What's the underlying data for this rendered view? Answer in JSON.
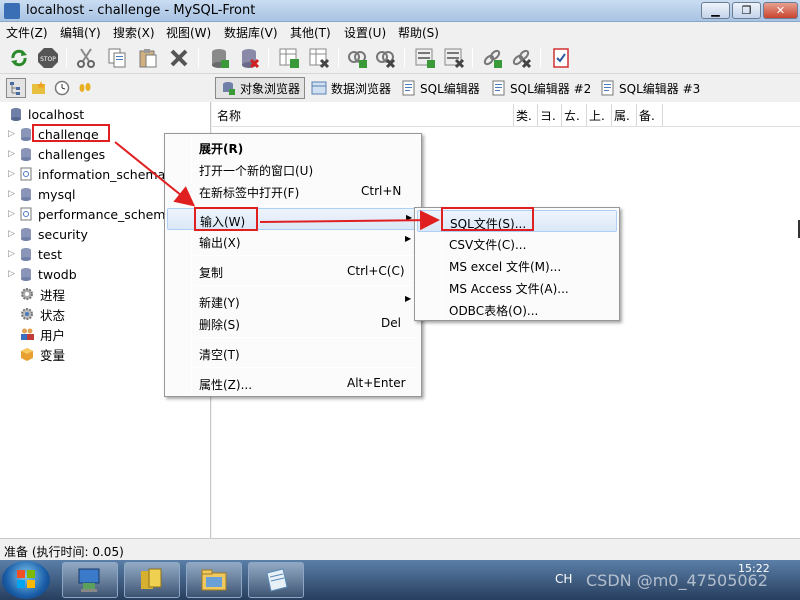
{
  "window": {
    "title": "localhost - challenge - MySQL-Front",
    "min": "▁",
    "max": "❐",
    "close": "✕"
  },
  "menubar": [
    "文件(Z)",
    "编辑(Y)",
    "搜索(X)",
    "视图(W)",
    "数据库(V)",
    "其他(T)",
    "设置(U)",
    "帮助(S)"
  ],
  "toolbar2": {
    "buttons": [
      "对象浏览器",
      "数据浏览器",
      "SQL编辑器",
      "SQL编辑器 #2",
      "SQL编辑器 #3"
    ],
    "active": "对象浏览器"
  },
  "tree": {
    "root": "localhost",
    "databases": [
      "challenge",
      "challenges",
      "information_schema",
      "mysql",
      "performance_schema",
      "security",
      "test",
      "twodb"
    ],
    "selected": "challenge",
    "extras": [
      "进程",
      "状态",
      "用户",
      "变量"
    ]
  },
  "rightpane": {
    "columns": [
      "名称",
      "类.",
      "ヨ.",
      "ㄊ.",
      "上.",
      "属.",
      "备."
    ]
  },
  "context_menu": {
    "items": [
      {
        "label": "展开(R)",
        "shortcut": "",
        "submenu": false
      },
      {
        "label": "打开一个新的窗口(U)",
        "shortcut": "",
        "submenu": false
      },
      {
        "label": "在新标签中打开(F)",
        "shortcut": "Ctrl+N",
        "submenu": false
      },
      {
        "label": "输入(W)",
        "shortcut": "",
        "submenu": true
      },
      {
        "label": "输出(X)",
        "shortcut": "",
        "submenu": true
      },
      {
        "label": "复制",
        "shortcut": "Ctrl+C(C)",
        "submenu": false
      },
      {
        "label": "新建(Y)",
        "shortcut": "",
        "submenu": true
      },
      {
        "label": "删除(S)",
        "shortcut": "Del",
        "submenu": false
      },
      {
        "label": "清空(T)",
        "shortcut": "",
        "submenu": false
      },
      {
        "label": "属性(Z)...",
        "shortcut": "Alt+Enter",
        "submenu": false
      }
    ],
    "highlighted": "输入(W)"
  },
  "import_submenu": {
    "items": [
      "SQL文件(S)...",
      "CSV文件(C)...",
      "MS excel 文件(M)...",
      "MS Access 文件(A)...",
      "ODBC表格(O)..."
    ],
    "highlighted": "SQL文件(S)..."
  },
  "statusbar": {
    "text": "准备  (执行时间: 0.05)"
  },
  "taskbar": {
    "lang": "CH",
    "clock": "15:22",
    "watermark": "CSDN @m0_47505062"
  },
  "colors": {
    "annotation_red": "#e02020",
    "db_icon": "#6f7fa8",
    "menu_hover": "#dbe8f7"
  }
}
